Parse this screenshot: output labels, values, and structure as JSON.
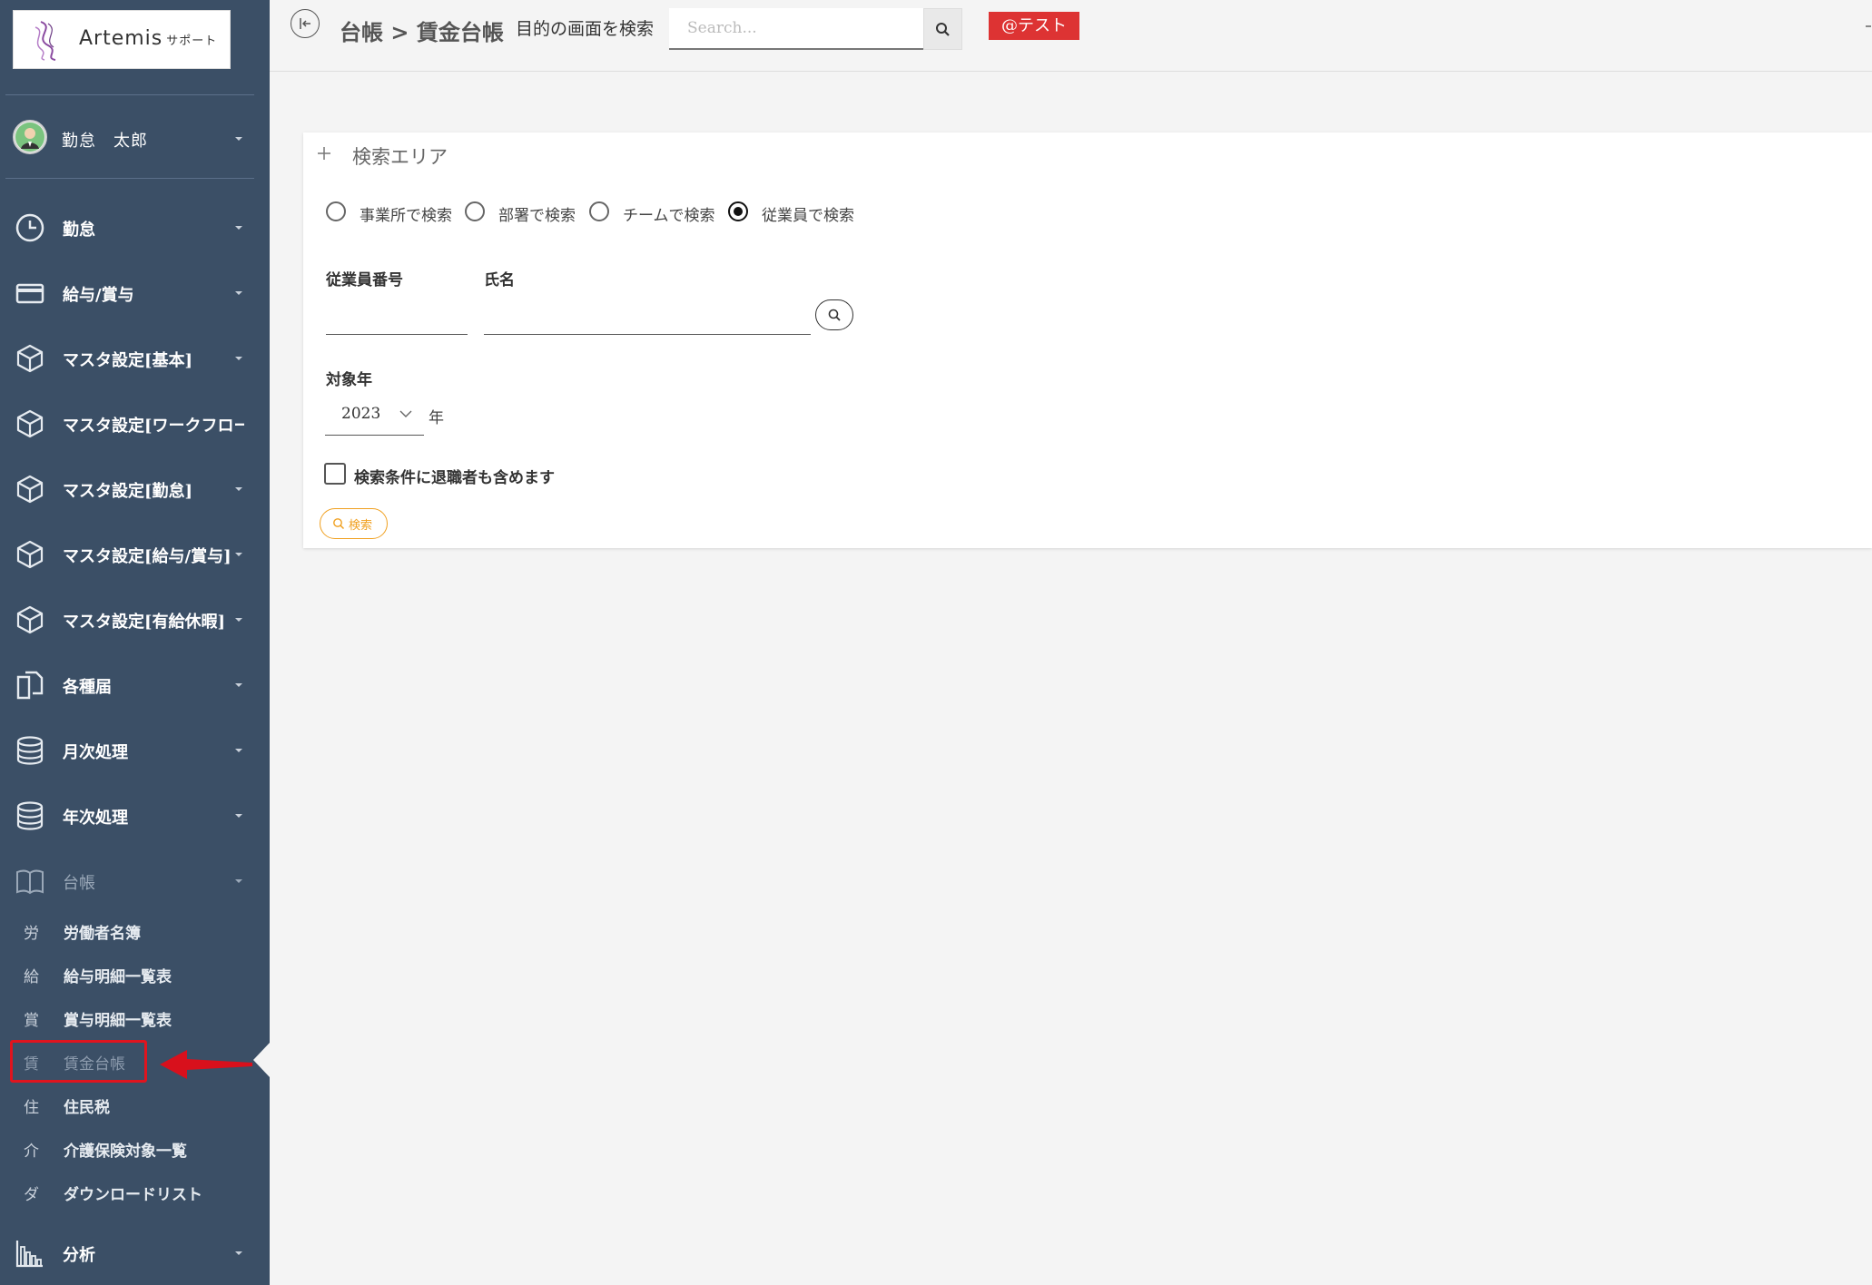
{
  "app": {
    "logo_text": "Artemis",
    "logo_sub": "サポート"
  },
  "user": {
    "name": "勤怠　太郎"
  },
  "sidebar": {
    "menu": [
      {
        "label": "勤怠",
        "icon": "clock-icon"
      },
      {
        "label": "給与/賞与",
        "icon": "credit-card-icon"
      },
      {
        "label": "マスタ設定[基本]",
        "icon": "cube-icon"
      },
      {
        "label": "マスタ設定[ワークフロー]",
        "icon": "cube-icon"
      },
      {
        "label": "マスタ設定[勤怠]",
        "icon": "cube-icon"
      },
      {
        "label": "マスタ設定[給与/賞与]",
        "icon": "cube-icon"
      },
      {
        "label": "マスタ設定[有給休暇]",
        "icon": "cube-icon"
      },
      {
        "label": "各種届",
        "icon": "documents-icon"
      },
      {
        "label": "月次処理",
        "icon": "database-icon"
      },
      {
        "label": "年次処理",
        "icon": "database-icon"
      },
      {
        "label": "台帳",
        "icon": "book-icon"
      }
    ],
    "ledger_items": [
      {
        "abbr": "労",
        "label": "労働者名簿"
      },
      {
        "abbr": "給",
        "label": "給与明細一覧表"
      },
      {
        "abbr": "賞",
        "label": "賞与明細一覧表"
      },
      {
        "abbr": "賃",
        "label": "賃金台帳"
      },
      {
        "abbr": "住",
        "label": "住民税"
      },
      {
        "abbr": "介",
        "label": "介護保険対象一覧"
      },
      {
        "abbr": "ダ",
        "label": "ダウンロードリスト"
      }
    ],
    "analysis": {
      "label": "分析",
      "icon": "bar-chart-icon"
    },
    "active_item": "賃金台帳"
  },
  "header": {
    "breadcrumb": "台帳 > 賃金台帳",
    "screen_search_label": "目的の画面を検索",
    "search_placeholder": "Search...",
    "tag": "@テスト"
  },
  "search_area": {
    "title": "検索エリア",
    "radio_options": [
      {
        "label": "事業所で検索",
        "checked": false
      },
      {
        "label": "部署で検索",
        "checked": false
      },
      {
        "label": "チームで検索",
        "checked": false
      },
      {
        "label": "従業員で検索",
        "checked": true
      }
    ],
    "employee_number_label": "従業員番号",
    "name_label": "氏名",
    "target_year_label": "対象年",
    "target_year_value": "2023",
    "year_unit": "年",
    "include_retired_label": "検索条件に退職者も含めます",
    "search_button_label": "検索"
  },
  "colors": {
    "sidebar_bg": "#3b4f66",
    "tag_bg": "#dd3333",
    "search_button": "#f0a020",
    "highlight": "#e0141e"
  }
}
